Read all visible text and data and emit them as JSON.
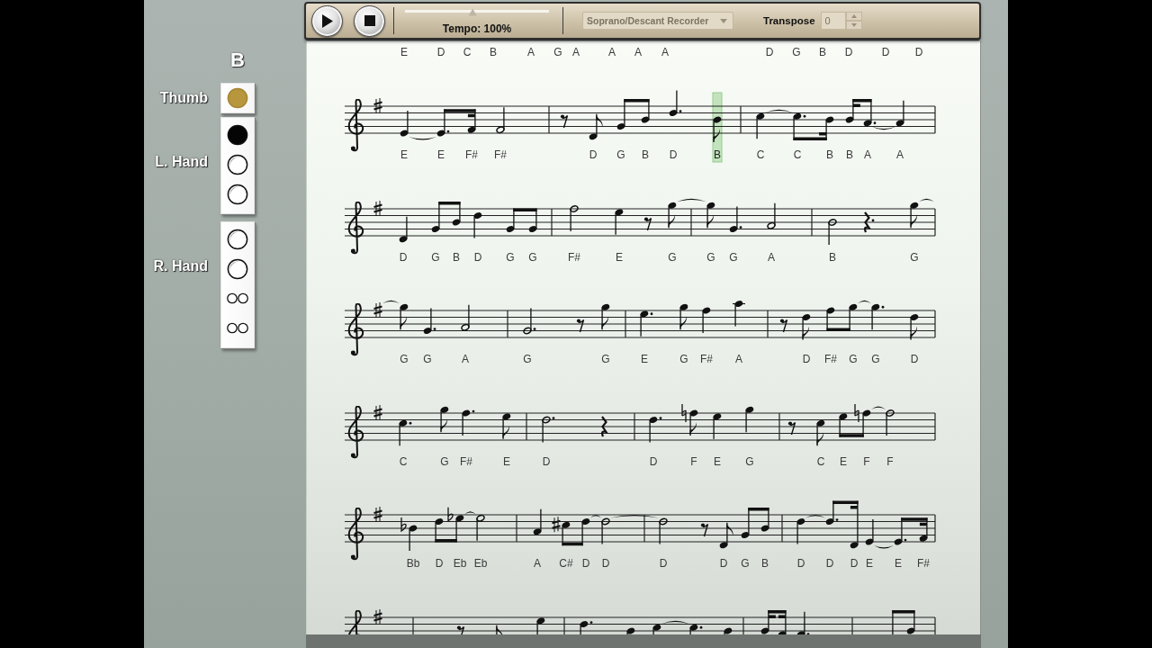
{
  "toolbar": {
    "tempo": {
      "label": "Tempo: 100%",
      "level": 0.47
    },
    "instrument": {
      "value": "Soprano/Descant Recorder",
      "disabled": true
    },
    "transpose": {
      "label": "Transpose",
      "value": "0",
      "disabled": true
    }
  },
  "fingering": {
    "note": "B",
    "thumb": {
      "label": "Thumb",
      "covered": true
    },
    "hands": [
      {
        "label": "L. Hand",
        "holes": [
          {
            "kind": "single",
            "covered": true
          },
          {
            "kind": "single",
            "covered": false
          },
          {
            "kind": "single",
            "covered": false
          }
        ]
      },
      {
        "label": "R. Hand",
        "holes": [
          {
            "kind": "single",
            "covered": false
          },
          {
            "kind": "single",
            "covered": false
          },
          {
            "kind": "double",
            "covered": false
          },
          {
            "kind": "double",
            "covered": false
          }
        ]
      }
    ]
  },
  "score": {
    "top_note_names": [
      "E",
      "D",
      "C",
      "B",
      "A",
      "G",
      "A",
      "A",
      "A",
      "A",
      "D",
      "G",
      "B",
      "D",
      "D",
      "D"
    ],
    "systems": [
      {
        "notes": [
          {
            "label": "E",
            "current": false
          },
          {
            "label": "E",
            "current": false
          },
          {
            "label": "F#",
            "current": false
          },
          {
            "label": "F#",
            "current": false
          },
          {
            "label": "D",
            "current": false
          },
          {
            "label": "G",
            "current": false
          },
          {
            "label": "B",
            "current": false
          },
          {
            "label": "D",
            "current": false
          },
          {
            "label": "B",
            "current": true
          },
          {
            "label": "C",
            "current": false
          },
          {
            "label": "C",
            "current": false
          },
          {
            "label": "B",
            "current": false
          },
          {
            "label": "B",
            "current": false
          },
          {
            "label": "A",
            "current": false
          },
          {
            "label": "A",
            "current": false
          }
        ]
      },
      {
        "notes": [
          {
            "label": "D",
            "current": false
          },
          {
            "label": "G",
            "current": false
          },
          {
            "label": "B",
            "current": false
          },
          {
            "label": "D",
            "current": false
          },
          {
            "label": "G",
            "current": false
          },
          {
            "label": "G",
            "current": false
          },
          {
            "label": "F#",
            "current": false
          },
          {
            "label": "E",
            "current": false
          },
          {
            "label": "G",
            "current": false
          },
          {
            "label": "G",
            "current": false
          },
          {
            "label": "G",
            "current": false
          },
          {
            "label": "A",
            "current": false
          },
          {
            "label": "B",
            "current": false
          },
          {
            "label": "G",
            "current": false
          }
        ]
      },
      {
        "notes": [
          {
            "label": "G",
            "current": false
          },
          {
            "label": "G",
            "current": false
          },
          {
            "label": "A",
            "current": false
          },
          {
            "label": "G",
            "current": false
          },
          {
            "label": "G",
            "current": false
          },
          {
            "label": "E",
            "current": false
          },
          {
            "label": "G",
            "current": false
          },
          {
            "label": "F#",
            "current": false
          },
          {
            "label": "A",
            "current": false
          },
          {
            "label": "D",
            "current": false
          },
          {
            "label": "F#",
            "current": false
          },
          {
            "label": "G",
            "current": false
          },
          {
            "label": "G",
            "current": false
          },
          {
            "label": "D",
            "current": false
          }
        ]
      },
      {
        "notes": [
          {
            "label": "C",
            "current": false
          },
          {
            "label": "G",
            "current": false
          },
          {
            "label": "F#",
            "current": false
          },
          {
            "label": "E",
            "current": false
          },
          {
            "label": "D",
            "current": false
          },
          {
            "label": "D",
            "current": false
          },
          {
            "label": "F",
            "current": false
          },
          {
            "label": "E",
            "current": false
          },
          {
            "label": "G",
            "current": false
          },
          {
            "label": "C",
            "current": false
          },
          {
            "label": "E",
            "current": false
          },
          {
            "label": "F",
            "current": false
          },
          {
            "label": "F",
            "current": false
          }
        ]
      },
      {
        "notes": [
          {
            "label": "Bb",
            "current": false
          },
          {
            "label": "D",
            "current": false
          },
          {
            "label": "Eb",
            "current": false
          },
          {
            "label": "Eb",
            "current": false
          },
          {
            "label": "A",
            "current": false
          },
          {
            "label": "C#",
            "current": false
          },
          {
            "label": "D",
            "current": false
          },
          {
            "label": "D",
            "current": false
          },
          {
            "label": "D",
            "current": false
          },
          {
            "label": "D",
            "current": false
          },
          {
            "label": "G",
            "current": false
          },
          {
            "label": "B",
            "current": false
          },
          {
            "label": "D",
            "current": false
          },
          {
            "label": "D",
            "current": false
          },
          {
            "label": "D",
            "current": false
          },
          {
            "label": "E",
            "current": false
          },
          {
            "label": "E",
            "current": false
          },
          {
            "label": "F#",
            "current": false
          }
        ]
      }
    ]
  }
}
